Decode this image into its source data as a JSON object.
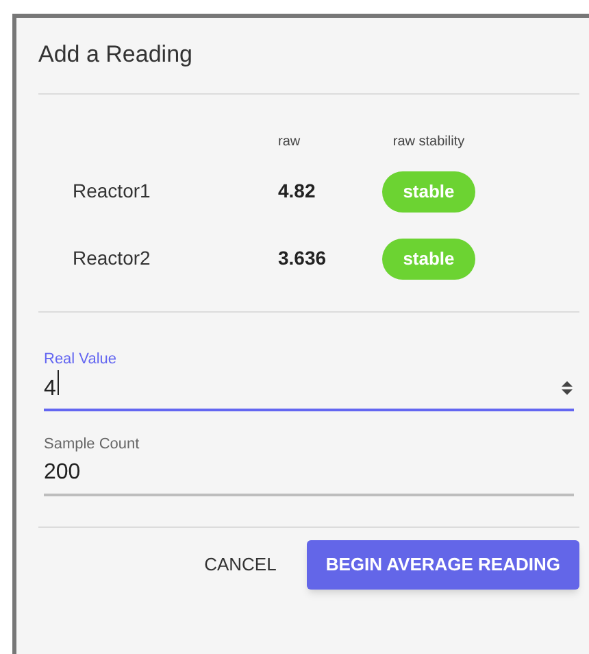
{
  "dialog": {
    "title": "Add a Reading"
  },
  "table": {
    "columns": [
      "raw",
      "raw stability"
    ],
    "rows": [
      {
        "name": "Reactor1",
        "raw": "4.82",
        "stability": "stable",
        "color": "#6cd332"
      },
      {
        "name": "Reactor2",
        "raw": "3.636",
        "stability": "stable",
        "color": "#6cd332"
      }
    ]
  },
  "fields": [
    {
      "label": "Real Value",
      "value": "4",
      "focused": true,
      "kind": "number"
    },
    {
      "label": "Sample Count",
      "value": "200",
      "focused": false,
      "kind": "text"
    }
  ],
  "buttons": [
    {
      "label": "CANCEL",
      "kind": "text"
    },
    {
      "label": "BEGIN AVERAGE READING",
      "kind": "primary"
    }
  ]
}
